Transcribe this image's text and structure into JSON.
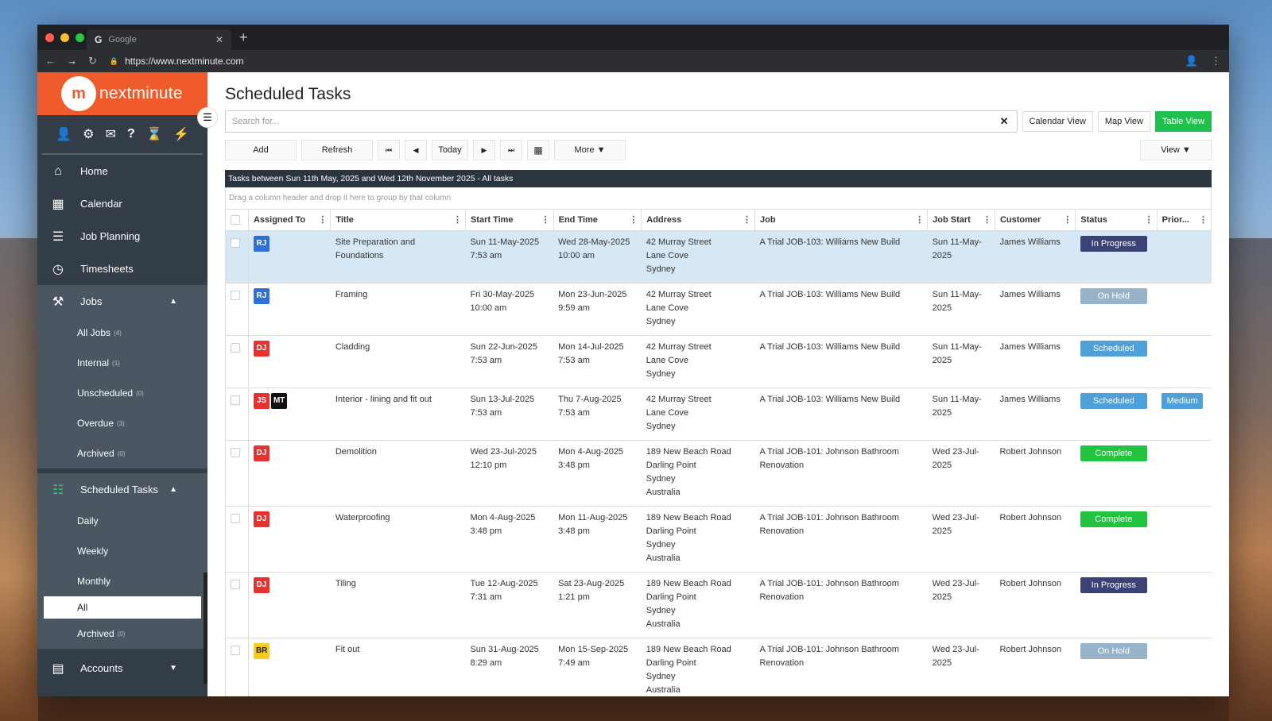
{
  "browser": {
    "tab_title": "Google",
    "tab_icon": "G",
    "url": "https://www.nextminute.com"
  },
  "logo": {
    "mark": "m",
    "text": "nextminute"
  },
  "sidebar": {
    "nav": [
      {
        "label": "Home",
        "icon": "home-icon"
      },
      {
        "label": "Calendar",
        "icon": "calendar-icon"
      },
      {
        "label": "Job Planning",
        "icon": "list-icon"
      },
      {
        "label": "Timesheets",
        "icon": "clock-icon"
      }
    ],
    "jobs": {
      "label": "Jobs",
      "items": [
        {
          "label": "All Jobs",
          "count": "(4)"
        },
        {
          "label": "Internal",
          "count": "(1)"
        },
        {
          "label": "Unscheduled",
          "count": "(0)"
        },
        {
          "label": "Overdue",
          "count": "(3)"
        },
        {
          "label": "Archived",
          "count": "(0)"
        }
      ]
    },
    "scheduled": {
      "label": "Scheduled Tasks",
      "items": [
        {
          "label": "Daily",
          "count": ""
        },
        {
          "label": "Weekly",
          "count": ""
        },
        {
          "label": "Monthly",
          "count": ""
        },
        {
          "label": "All",
          "count": ""
        },
        {
          "label": "Archived",
          "count": "(0)"
        }
      ]
    },
    "accounts": {
      "label": "Accounts"
    }
  },
  "main": {
    "title": "Scheduled Tasks",
    "search_placeholder": "Search for...",
    "views": [
      "Calendar View",
      "Map View",
      "Table View"
    ],
    "toolbar": {
      "add": "Add",
      "refresh": "Refresh",
      "today": "Today",
      "more": "More ▼",
      "view": "View ▼"
    },
    "grid_caption": "Tasks between Sun 11th May, 2025 and Wed 12th November 2025 - All tasks",
    "group_hint": "Drag a column header and drop it here to group by that column",
    "columns": [
      "Assigned To",
      "Title",
      "Start Time",
      "End Time",
      "Address",
      "Job",
      "Job Start",
      "Customer",
      "Status",
      "Prior..."
    ]
  },
  "colors": {
    "RJ": "#2f6fd6",
    "DJ": "#e8312f",
    "JS": "#e8312f",
    "MT": "#111111",
    "BR": "#f5cc1f",
    "In Progress": "#3b4275",
    "On Hold": "#97b3c9",
    "Scheduled": "#4ea0d8",
    "Complete": "#22c33f",
    "Medium": "#4ea0d8"
  },
  "rows": [
    {
      "assigned": [
        "RJ"
      ],
      "title": "Site Preparation and Foundations",
      "start": [
        "Sun 11-May-2025",
        "7:53 am"
      ],
      "end": [
        "Wed 28-May-2025",
        "10:00 am"
      ],
      "address": [
        "42 Murray Street",
        "Lane Cove",
        "Sydney"
      ],
      "job": "A Trial JOB-103: Williams New Build",
      "job_start": [
        "Sun 11-May-",
        "2025"
      ],
      "customer": "James Williams",
      "status": "In Progress",
      "priority": "",
      "selected": true
    },
    {
      "assigned": [
        "RJ"
      ],
      "title": "Framing",
      "start": [
        "Fri 30-May-2025",
        "10:00 am"
      ],
      "end": [
        "Mon 23-Jun-2025",
        "9:59 am"
      ],
      "address": [
        "42 Murray Street",
        "Lane Cove",
        "Sydney"
      ],
      "job": "A Trial JOB-103: Williams New Build",
      "job_start": [
        "Sun 11-May-",
        "2025"
      ],
      "customer": "James Williams",
      "status": "On Hold",
      "priority": ""
    },
    {
      "assigned": [
        "DJ"
      ],
      "title": "Cladding",
      "start": [
        "Sun 22-Jun-2025",
        "7:53 am"
      ],
      "end": [
        "Mon 14-Jul-2025",
        "7:53 am"
      ],
      "address": [
        "42 Murray Street",
        "Lane Cove",
        "Sydney"
      ],
      "job": "A Trial JOB-103: Williams New Build",
      "job_start": [
        "Sun 11-May-",
        "2025"
      ],
      "customer": "James Williams",
      "status": "Scheduled",
      "priority": ""
    },
    {
      "assigned": [
        "JS",
        "MT"
      ],
      "title": "Interior - lining and fit out",
      "start": [
        "Sun 13-Jul-2025",
        "7:53 am"
      ],
      "end": [
        "Thu 7-Aug-2025",
        "7:53 am"
      ],
      "address": [
        "42 Murray Street",
        "Lane Cove",
        "Sydney"
      ],
      "job": "A Trial JOB-103: Williams New Build",
      "job_start": [
        "Sun 11-May-",
        "2025"
      ],
      "customer": "James Williams",
      "status": "Scheduled",
      "priority": "Medium"
    },
    {
      "assigned": [
        "DJ"
      ],
      "title": "Demolition",
      "start": [
        "Wed 23-Jul-2025",
        "12:10 pm"
      ],
      "end": [
        "Mon 4-Aug-2025",
        "3:48 pm"
      ],
      "address": [
        "189 New Beach Road",
        "Darling Point",
        "Sydney",
        "Australia"
      ],
      "job": "A Trial JOB-101: Johnson Bathroom Renovation",
      "job_start": [
        "Wed 23-Jul-",
        "2025"
      ],
      "customer": "Robert Johnson",
      "status": "Complete",
      "priority": ""
    },
    {
      "assigned": [
        "DJ"
      ],
      "title": "Waterproofing",
      "start": [
        "Mon 4-Aug-2025",
        "3:48 pm"
      ],
      "end": [
        "Mon 11-Aug-2025",
        "3:48 pm"
      ],
      "address": [
        "189 New Beach Road",
        "Darling Point",
        "Sydney",
        "Australia"
      ],
      "job": "A Trial JOB-101: Johnson Bathroom Renovation",
      "job_start": [
        "Wed 23-Jul-",
        "2025"
      ],
      "customer": "Robert Johnson",
      "status": "Complete",
      "priority": ""
    },
    {
      "assigned": [
        "DJ"
      ],
      "title": "Tiling",
      "start": [
        "Tue 12-Aug-2025",
        "7:31 am"
      ],
      "end": [
        "Sat 23-Aug-2025",
        "1:21 pm"
      ],
      "address": [
        "189 New Beach Road",
        "Darling Point",
        "Sydney",
        "Australia"
      ],
      "job": "A Trial JOB-101: Johnson Bathroom Renovation",
      "job_start": [
        "Wed 23-Jul-",
        "2025"
      ],
      "customer": "Robert Johnson",
      "status": "In Progress",
      "priority": ""
    },
    {
      "assigned": [
        "BR"
      ],
      "title": "Fit out",
      "start": [
        "Sun 31-Aug-2025",
        "8:29 am"
      ],
      "end": [
        "Mon 15-Sep-2025",
        "7:49 am"
      ],
      "address": [
        "189 New Beach Road",
        "Darling Point",
        "Sydney",
        "Australia"
      ],
      "job": "A Trial JOB-101: Johnson Bathroom Renovation",
      "job_start": [
        "Wed 23-Jul-",
        "2025"
      ],
      "customer": "Robert Johnson",
      "status": "On Hold",
      "priority": ""
    }
  ]
}
